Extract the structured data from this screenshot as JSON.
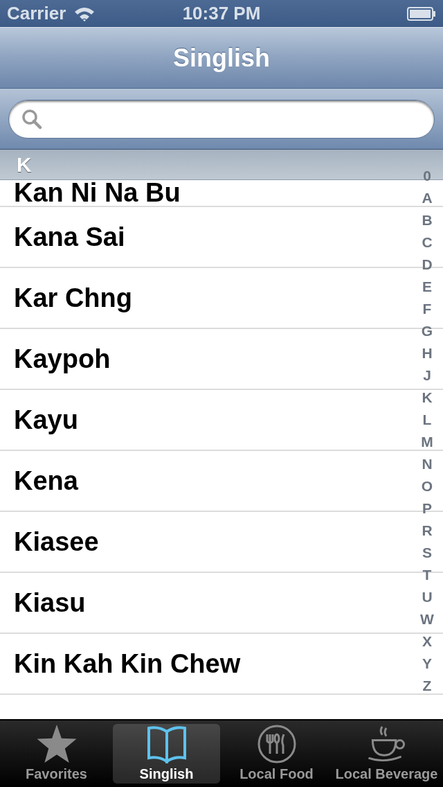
{
  "status_bar": {
    "carrier": "Carrier",
    "time": "10:37 PM"
  },
  "nav": {
    "title": "Singlish"
  },
  "section": {
    "title": "K"
  },
  "rows": [
    "Kan Ni Na Bu",
    "Kana Sai",
    "Kar Chng",
    "Kaypoh",
    "Kayu",
    "Kena",
    "Kiasee",
    "Kiasu",
    "Kin Kah Kin Chew"
  ],
  "index": [
    "0",
    "A",
    "B",
    "C",
    "D",
    "E",
    "F",
    "G",
    "H",
    "J",
    "K",
    "L",
    "M",
    "N",
    "O",
    "P",
    "R",
    "S",
    "T",
    "U",
    "W",
    "X",
    "Y",
    "Z"
  ],
  "tabs": [
    {
      "label": "Favorites",
      "kind": "star",
      "selected": false
    },
    {
      "label": "Singlish",
      "kind": "book",
      "selected": true
    },
    {
      "label": "Local Food",
      "kind": "plate",
      "selected": false
    },
    {
      "label": "Local Beverage",
      "kind": "cup",
      "selected": false
    }
  ]
}
